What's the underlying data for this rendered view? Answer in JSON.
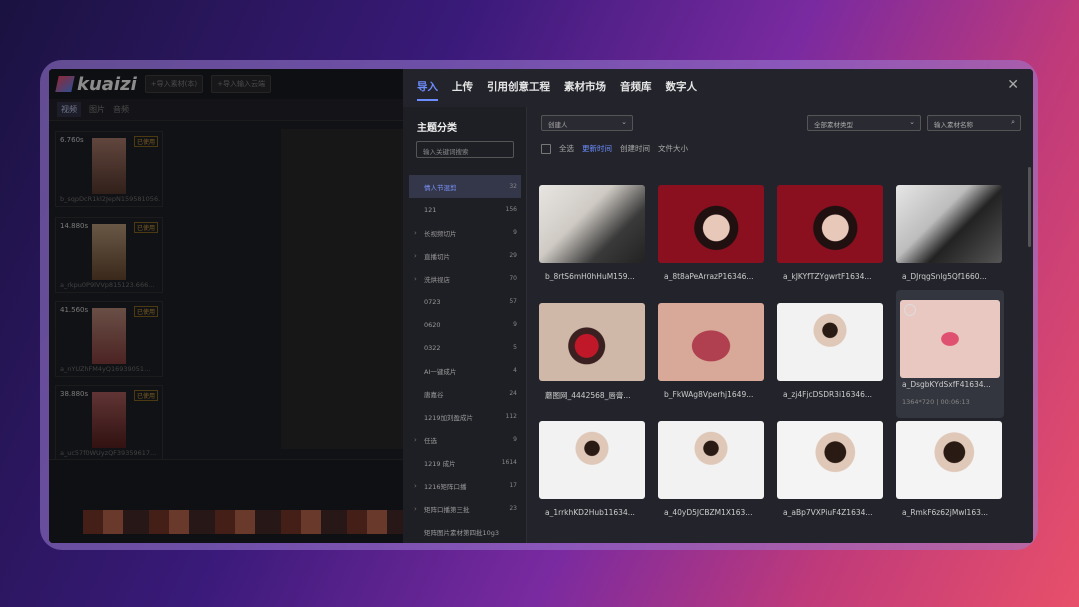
{
  "editor": {
    "logo": "kuaizi",
    "btn_import_media": "+导入素材(本)",
    "btn_import_other": "+导入输入云端",
    "tabs": [
      "视频",
      "图片",
      "音频"
    ],
    "clips": [
      {
        "duration": "6.760s",
        "used": "已使用",
        "name": "b_sqpDcR1kl2JepN159581056..."
      },
      {
        "duration": "14.880s",
        "used": "已使用",
        "name": "a_rkpu0P9lVVp815123.666..."
      },
      {
        "duration": "41.560s",
        "used": "已使用",
        "name": "a_nYUZhFM4yQ16939051..."
      },
      {
        "duration": "38.880s",
        "used": "已使用",
        "name": "a_uc57f0WUyzQF39359617..."
      }
    ]
  },
  "dialog": {
    "tabs": [
      "导入",
      "上传",
      "引用创意工程",
      "素材市场",
      "音频库",
      "数字人"
    ],
    "close": "✕",
    "category_title": "主题分类",
    "category_search_placeholder": "输入关键词搜索",
    "categories": [
      {
        "label": "情人节混剪",
        "count": "32",
        "arrow": "",
        "active": true
      },
      {
        "label": "121",
        "count": "156",
        "arrow": ""
      },
      {
        "label": "长视频切片",
        "count": "9",
        "arrow": "›"
      },
      {
        "label": "直播切片",
        "count": "29",
        "arrow": "›"
      },
      {
        "label": "洗烘视店",
        "count": "70",
        "arrow": "›"
      },
      {
        "label": "0723",
        "count": "57",
        "arrow": ""
      },
      {
        "label": "0620",
        "count": "9",
        "arrow": ""
      },
      {
        "label": "0322",
        "count": "5",
        "arrow": ""
      },
      {
        "label": "AI一键成片",
        "count": "4",
        "arrow": ""
      },
      {
        "label": "唐嘉谷",
        "count": "24",
        "arrow": ""
      },
      {
        "label": "1219加刘盈成片",
        "count": "112",
        "arrow": ""
      },
      {
        "label": "任选",
        "count": "9",
        "arrow": "›"
      },
      {
        "label": "1219 成片",
        "count": "1614",
        "arrow": ""
      },
      {
        "label": "1216矩阵口播",
        "count": "17",
        "arrow": "›"
      },
      {
        "label": "矩阵口播第三批",
        "count": "23",
        "arrow": "›"
      },
      {
        "label": "矩阵图片素材第四批10g3",
        "count": "",
        "arrow": ""
      }
    ],
    "filter_creator": "创建人",
    "filter_type": "全部素材类型",
    "filter_name_placeholder": "输入素材名称",
    "select_all": "全选",
    "sort": [
      "更新时间",
      "创建时间",
      "文件大小"
    ],
    "cards": [
      {
        "name": "b_8rtS6mH0hHuM159...",
        "g": "g1"
      },
      {
        "name": "a_8t8aPeArrazP16346...",
        "g": "g2"
      },
      {
        "name": "a_kJKYfTZYgwrtF1634...",
        "g": "g2"
      },
      {
        "name": "a_DJrqgSnlg5Qf1660...",
        "g": "g3"
      },
      {
        "name": "蘑图网_4442568_唇膏...",
        "g": "g4"
      },
      {
        "name": "b_FkWAg8Vperhj1649...",
        "g": "g5"
      },
      {
        "name": "a_zj4FjcDSDR3i16346...",
        "g": "g6"
      },
      {
        "name": "a_DsgbKYdSxfF41634...",
        "g": "g7",
        "meta": "1364*720 | 00:06:13",
        "highlight": true
      },
      {
        "name": "a_1rrkhKD2Hub11634...",
        "g": "g6"
      },
      {
        "name": "a_40yD5JCBZM1X163...",
        "g": "g6"
      },
      {
        "name": "a_aBp7VXPiuF4Z1634...",
        "g": "g8"
      },
      {
        "name": "a_RmkF6z62jMwl163...",
        "g": "g8"
      }
    ]
  }
}
